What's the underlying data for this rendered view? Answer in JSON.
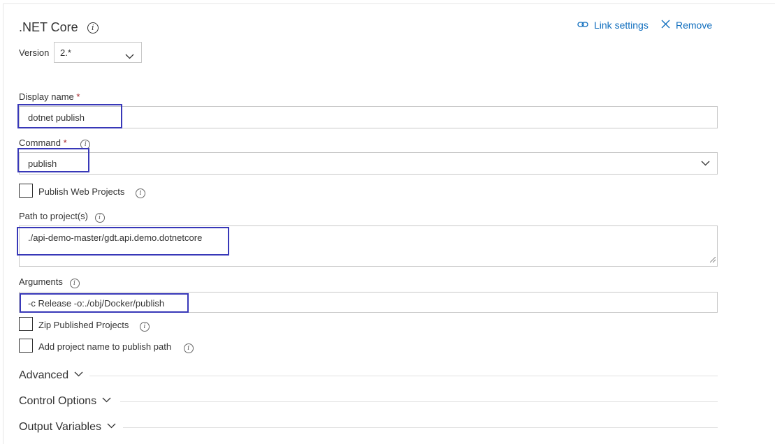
{
  "header": {
    "title": ".NET Core",
    "link_settings": "Link settings",
    "remove": "Remove"
  },
  "version": {
    "label": "Version",
    "value": "2.*"
  },
  "display_name": {
    "label": "Display name",
    "required": "*",
    "value": "dotnet publish"
  },
  "command": {
    "label": "Command",
    "required": "*",
    "value": "publish"
  },
  "publish_web_projects": {
    "label": "Publish Web Projects",
    "checked": false
  },
  "path_to_projects": {
    "label": "Path to project(s)",
    "value": "./api-demo-master/gdt.api.demo.dotnetcore"
  },
  "arguments": {
    "label": "Arguments",
    "value": "-c Release -o:./obj/Docker/publish"
  },
  "zip_published": {
    "label": "Zip Published Projects",
    "checked": false
  },
  "add_project_name": {
    "label": "Add project name to publish path",
    "checked": false
  },
  "sections": {
    "advanced": "Advanced",
    "control_options": "Control Options",
    "output_variables": "Output Variables"
  },
  "colors": {
    "accent": "#106ebe",
    "highlight": "#3838b8",
    "required": "#a4262c"
  }
}
